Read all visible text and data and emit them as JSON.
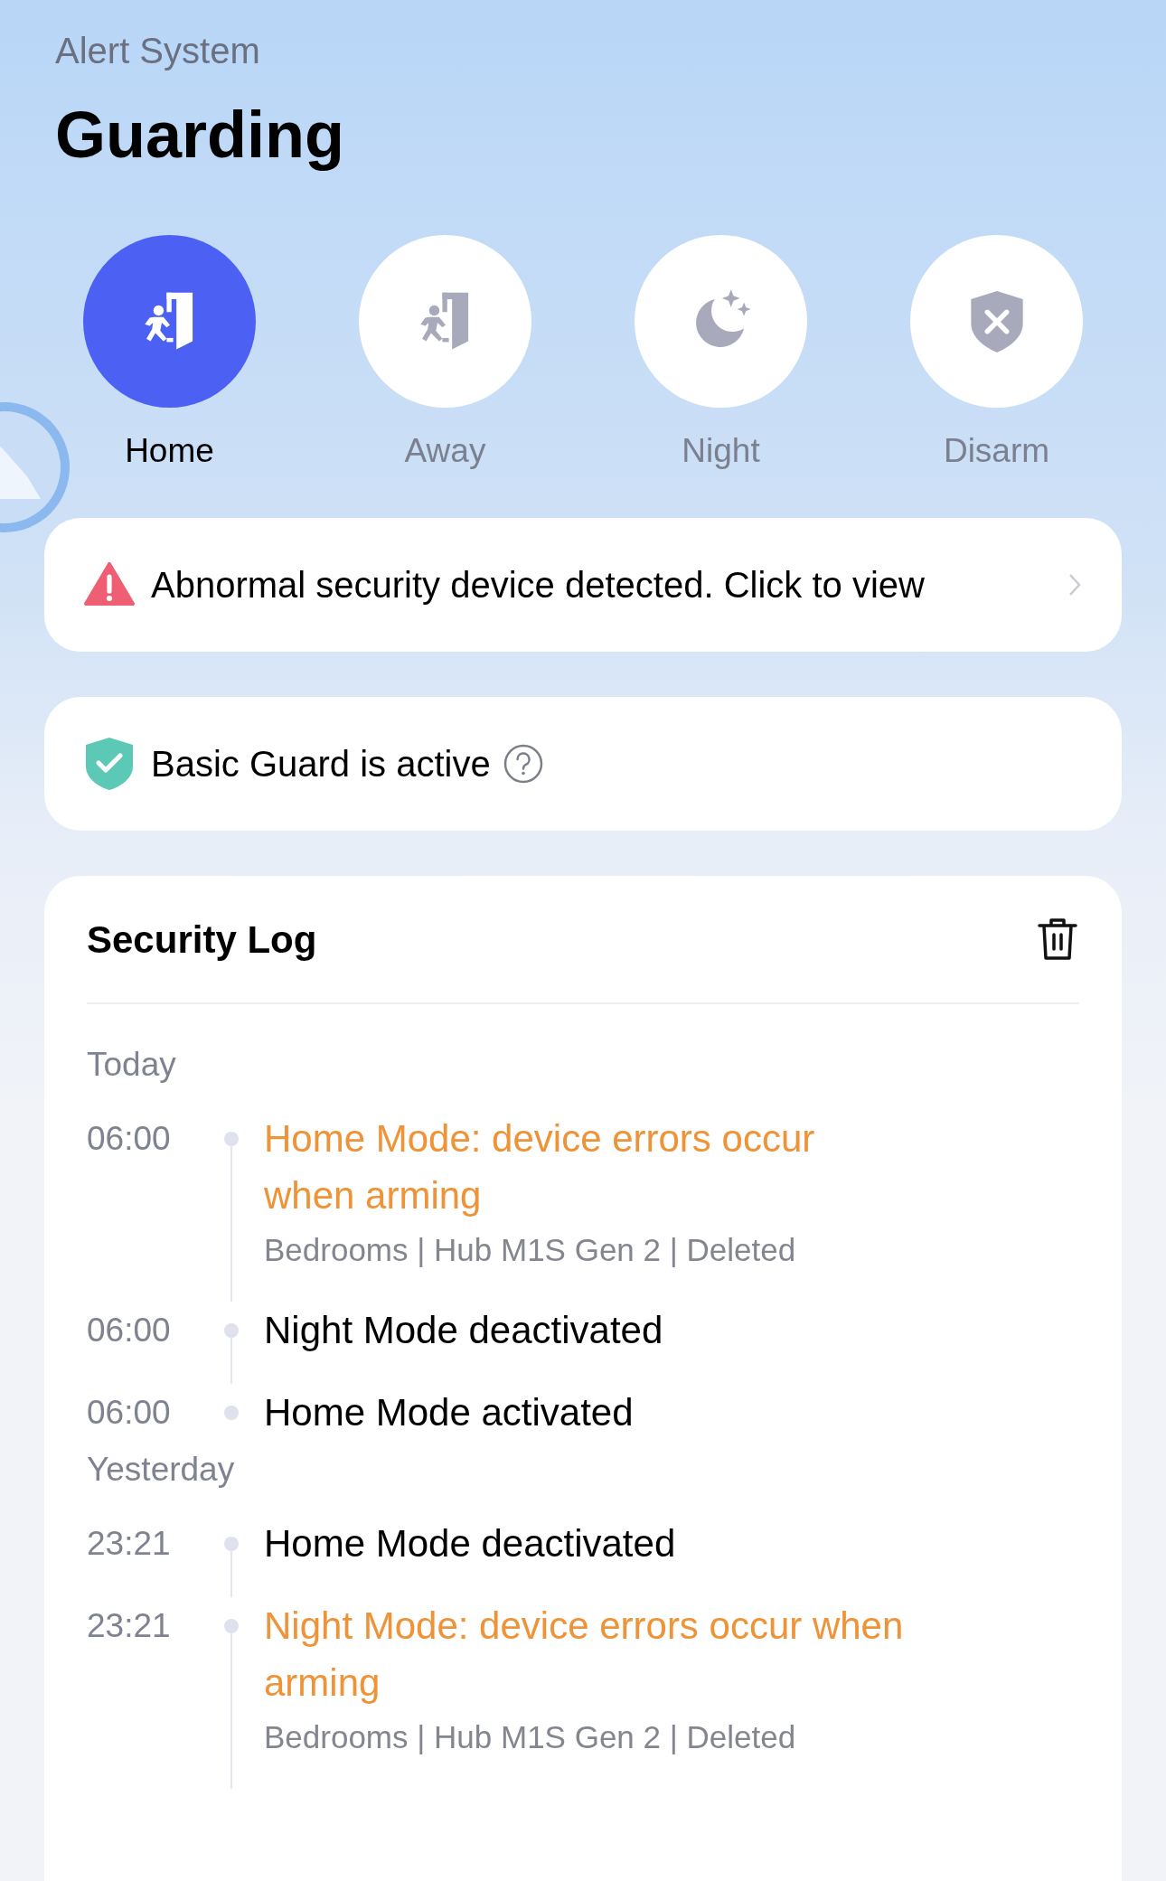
{
  "header": {
    "subtitle": "Alert System",
    "title": "Guarding"
  },
  "modes": [
    {
      "label": "Home",
      "kind": "home",
      "selected": true
    },
    {
      "label": "Away",
      "kind": "away",
      "selected": false
    },
    {
      "label": "Night",
      "kind": "night",
      "selected": false
    },
    {
      "label": "Disarm",
      "kind": "disarm",
      "selected": false
    }
  ],
  "alert": {
    "text": "Abnormal security device detected. Click to view"
  },
  "guard": {
    "text": "Basic Guard is active"
  },
  "log": {
    "title": "Security Log",
    "groups": [
      {
        "label": "Today",
        "entries": [
          {
            "time": "06:00",
            "kind": "error",
            "title": "Home Mode: device errors occur when arming",
            "detail": "Bedrooms | Hub M1S Gen 2 | Deleted"
          },
          {
            "time": "06:00",
            "kind": "normal",
            "title": "Night Mode deactivated"
          },
          {
            "time": "06:00",
            "kind": "normal",
            "title": "Home Mode activated"
          }
        ]
      },
      {
        "label": "Yesterday",
        "entries": [
          {
            "time": "23:21",
            "kind": "normal",
            "title": "Home Mode deactivated"
          },
          {
            "time": "23:21",
            "kind": "error",
            "title": "Night Mode: device errors occur when arming",
            "detail": "Bedrooms | Hub M1S Gen 2 | Deleted"
          }
        ]
      }
    ]
  }
}
